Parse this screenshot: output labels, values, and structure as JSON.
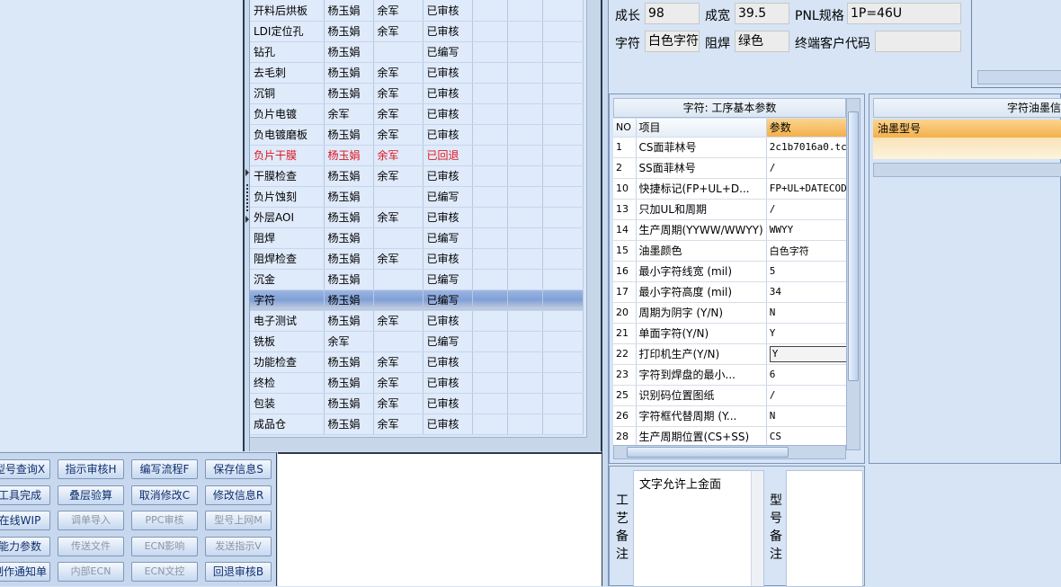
{
  "process_rows": [
    {
      "step": "开料后烘板",
      "editor": "杨玉娟",
      "reviewer": "余军",
      "status": "已审核"
    },
    {
      "step": "LDI定位孔",
      "editor": "杨玉娟",
      "reviewer": "余军",
      "status": "已审核"
    },
    {
      "step": "钻孔",
      "editor": "杨玉娟",
      "reviewer": "",
      "status": "已编写"
    },
    {
      "step": "去毛刺",
      "editor": "杨玉娟",
      "reviewer": "余军",
      "status": "已审核"
    },
    {
      "step": "沉铜",
      "editor": "杨玉娟",
      "reviewer": "余军",
      "status": "已审核"
    },
    {
      "step": "负片电镀",
      "editor": "余军",
      "reviewer": "余军",
      "status": "已审核"
    },
    {
      "step": "负电镀磨板",
      "editor": "杨玉娟",
      "reviewer": "余军",
      "status": "已审核"
    },
    {
      "step": "负片干膜",
      "editor": "杨玉娟",
      "reviewer": "余军",
      "status": "已回退",
      "highlight": "red"
    },
    {
      "step": "干膜检查",
      "editor": "杨玉娟",
      "reviewer": "余军",
      "status": "已审核"
    },
    {
      "step": "负片蚀刻",
      "editor": "杨玉娟",
      "reviewer": "",
      "status": "已编写"
    },
    {
      "step": "外层AOI",
      "editor": "杨玉娟",
      "reviewer": "余军",
      "status": "已审核"
    },
    {
      "step": "阻焊",
      "editor": "杨玉娟",
      "reviewer": "",
      "status": "已编写"
    },
    {
      "step": "阻焊检查",
      "editor": "杨玉娟",
      "reviewer": "余军",
      "status": "已审核"
    },
    {
      "step": "沉金",
      "editor": "杨玉娟",
      "reviewer": "",
      "status": "已编写"
    },
    {
      "step": "字符",
      "editor": "杨玉娟",
      "reviewer": "",
      "status": "已编写",
      "selected": true
    },
    {
      "step": "电子测试",
      "editor": "杨玉娟",
      "reviewer": "余军",
      "status": "已审核"
    },
    {
      "step": "铣板",
      "editor": "余军",
      "reviewer": "",
      "status": "已编写"
    },
    {
      "step": "功能检查",
      "editor": "杨玉娟",
      "reviewer": "余军",
      "status": "已审核"
    },
    {
      "step": "终检",
      "editor": "杨玉娟",
      "reviewer": "余军",
      "status": "已审核"
    },
    {
      "step": "包装",
      "editor": "杨玉娟",
      "reviewer": "余军",
      "status": "已审核"
    },
    {
      "step": "成品仓",
      "editor": "杨玉娟",
      "reviewer": "余军",
      "status": "已审核"
    }
  ],
  "buttons": {
    "row1": [
      "型号查询X",
      "指示审核H",
      "编写流程F",
      "保存信息S"
    ],
    "row2": [
      "工具完成",
      "叠层验算",
      "取消修改C",
      "修改信息R"
    ],
    "row3": [
      "在线WIP",
      "调单导入",
      "PPC审核",
      "型号上网M"
    ],
    "row4": [
      "能力参数",
      "传送文件",
      "ECN影响",
      "发送指示V"
    ],
    "row5": [
      "制作通知单",
      "内部ECN",
      "ECN文控",
      "回退审核B"
    ]
  },
  "info": {
    "growth_label": "成长",
    "growth_value": "98",
    "width_label": "成宽",
    "width_value": "39.5",
    "pnl_label": "PNL规格",
    "pnl_value": "1P=46U",
    "char_label": "字符",
    "char_value": "白色字符",
    "mask_label": "阻焊",
    "mask_value": "绿色",
    "customer_label": "终端客户代码",
    "customer_value": ""
  },
  "params": {
    "title": "字符: 工序基本参数",
    "col_no": "NO",
    "col_item": "项目",
    "col_value": "参数",
    "rows": [
      {
        "no": "1",
        "item": "CS面菲林号",
        "value": "2c1b7016a0.tc"
      },
      {
        "no": "2",
        "item": "SS面菲林号",
        "value": "/"
      },
      {
        "no": "10",
        "item": "快捷标记(FP+UL+D...",
        "value": "FP+UL+DATECODE"
      },
      {
        "no": "13",
        "item": "只加UL和周期",
        "value": "/"
      },
      {
        "no": "14",
        "item": "生产周期(YYWW/WWYY)",
        "value": "WWYY"
      },
      {
        "no": "15",
        "item": "油墨颜色",
        "value": "白色字符"
      },
      {
        "no": "16",
        "item": "最小字符线宽 (mil)",
        "value": "5"
      },
      {
        "no": "17",
        "item": "最小字符高度 (mil)",
        "value": "34"
      },
      {
        "no": "20",
        "item": "周期为阴字 (Y/N)",
        "value": "N"
      },
      {
        "no": "21",
        "item": "单面字符(Y/N)",
        "value": "Y"
      },
      {
        "no": "22",
        "item": "打印机生产(Y/N)",
        "value": "Y",
        "editing": true
      },
      {
        "no": "23",
        "item": "字符到焊盘的最小...",
        "value": "6"
      },
      {
        "no": "25",
        "item": "识别码位置图纸",
        "value": "/"
      },
      {
        "no": "26",
        "item": "字符框代替周期 (Y...",
        "value": "N"
      },
      {
        "no": "28",
        "item": "生产周期位置(CS+SS)",
        "value": "CS"
      }
    ]
  },
  "ink": {
    "title": "字符油墨信息",
    "col_model": "油墨型号"
  },
  "remarks": {
    "process_label": "工艺备注",
    "process_text": "文字允许上金面",
    "model_label": "型号备注",
    "model_text": ""
  }
}
